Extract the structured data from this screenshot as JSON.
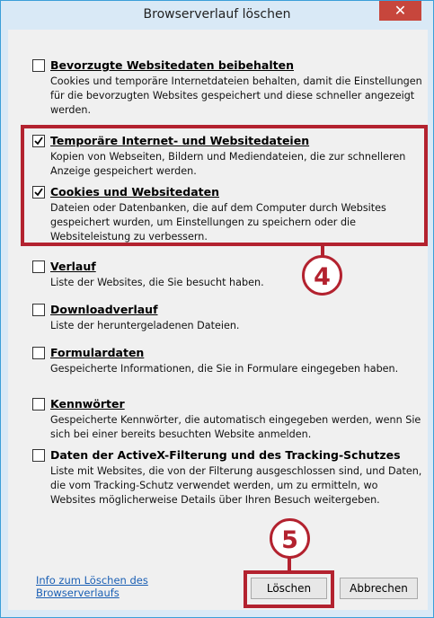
{
  "window": {
    "title": "Browserverlauf löschen",
    "close_glyph": "✕"
  },
  "options": [
    {
      "label": "Bevorzugte Websitedaten beibehalten",
      "checked": false,
      "desc": "Cookies und temporäre Internetdateien behalten, damit die Einstellungen für die bevorzugten Websites gespeichert und diese schneller angezeigt werden."
    },
    {
      "label": "Temporäre Internet- und Websitedateien",
      "checked": true,
      "desc": "Kopien von Webseiten, Bildern und Mediendateien, die zur schnelleren Anzeige gespeichert werden."
    },
    {
      "label": "Cookies und Websitedaten",
      "checked": true,
      "desc": "Dateien oder Datenbanken, die auf dem Computer durch Websites gespeichert wurden, um Einstellungen zu speichern oder die Websiteleistung zu verbessern."
    },
    {
      "label": "Verlauf",
      "checked": false,
      "desc": "Liste der Websites, die Sie besucht haben."
    },
    {
      "label": "Downloadverlauf",
      "checked": false,
      "desc": "Liste der heruntergeladenen Dateien."
    },
    {
      "label": "Formulardaten",
      "checked": false,
      "desc": "Gespeicherte Informationen, die Sie in Formulare eingegeben haben."
    },
    {
      "label": "Kennwörter",
      "checked": false,
      "desc": "Gespeicherte Kennwörter, die automatisch eingegeben werden, wenn Sie sich bei einer bereits besuchten Website anmelden."
    },
    {
      "label": "Daten der ActiveX-Filterung und des Tracking-Schutzes",
      "checked": false,
      "desc": "Liste mit Websites, die von der Filterung ausgeschlossen sind, und Daten, die vom Tracking-Schutz verwendet werden, um zu ermitteln, wo Websites möglicherweise Details über Ihren Besuch weitergeben."
    }
  ],
  "footer": {
    "info_link_line1": "Info zum Löschen des",
    "info_link_line2": "Browserverlaufs",
    "delete_label": "Löschen",
    "cancel_label": "Abbrechen"
  },
  "annotations": {
    "badge_4": "4",
    "badge_5": "5",
    "color": "#b3222f"
  }
}
